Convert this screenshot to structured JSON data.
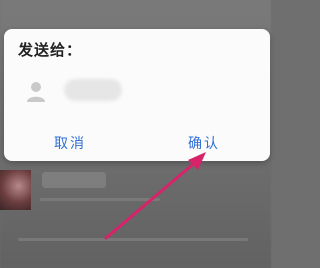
{
  "dialog": {
    "title": "发送给：",
    "recipient_icon": "person-icon",
    "cancel_label": "取消",
    "confirm_label": "确认"
  },
  "colors": {
    "accent": "#2f6fd8",
    "annotation_arrow": "#d8236a"
  }
}
